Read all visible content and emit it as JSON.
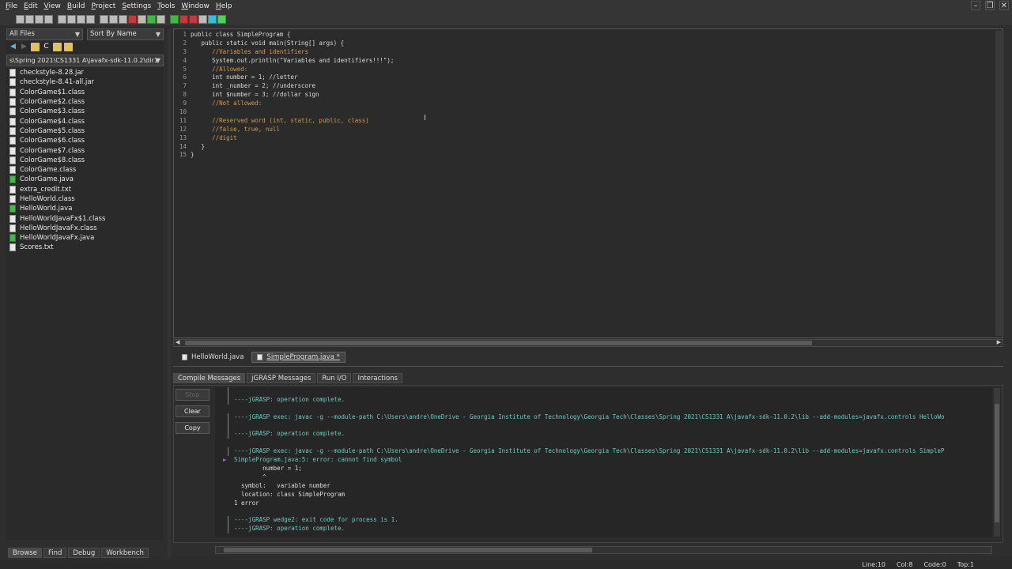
{
  "menu": [
    "File",
    "Edit",
    "View",
    "Build",
    "Project",
    "Settings",
    "Tools",
    "Window",
    "Help"
  ],
  "window_controls": [
    "minimize-icon",
    "restore-icon",
    "close-icon"
  ],
  "browser": {
    "filter": "All Files",
    "sort": "Sort By Name",
    "path": "s\\Spring 2021\\CS1331 A\\javafx-sdk-11.0.2\\dir1",
    "files": [
      {
        "name": "checkstyle-8.28.jar",
        "type": "file"
      },
      {
        "name": "checkstyle-8.41-all.jar",
        "type": "file"
      },
      {
        "name": "ColorGame$1.class",
        "type": "file"
      },
      {
        "name": "ColorGame$2.class",
        "type": "file"
      },
      {
        "name": "ColorGame$3.class",
        "type": "file"
      },
      {
        "name": "ColorGame$4.class",
        "type": "file"
      },
      {
        "name": "ColorGame$5.class",
        "type": "file"
      },
      {
        "name": "ColorGame$6.class",
        "type": "file"
      },
      {
        "name": "ColorGame$7.class",
        "type": "file"
      },
      {
        "name": "ColorGame$8.class",
        "type": "file"
      },
      {
        "name": "ColorGame.class",
        "type": "file"
      },
      {
        "name": "ColorGame.java",
        "type": "java"
      },
      {
        "name": "extra_credit.txt",
        "type": "file"
      },
      {
        "name": "HelloWorld.class",
        "type": "file"
      },
      {
        "name": "HelloWorld.java",
        "type": "java"
      },
      {
        "name": "HelloWorldJavaFx$1.class",
        "type": "file"
      },
      {
        "name": "HelloWorldJavaFx.class",
        "type": "file"
      },
      {
        "name": "HelloWorldJavaFx.java",
        "type": "java"
      },
      {
        "name": "Scores.txt",
        "type": "file"
      }
    ],
    "tabs": [
      "Browse",
      "Find",
      "Debug",
      "Workbench"
    ]
  },
  "editor": {
    "lines": [
      "public class SimpleProgram {",
      "   public static void main(String[] args) {",
      "      //Variables and identifiers",
      "      System.out.println(\"Variables and identifiers!!!\");",
      "      //Allowed:",
      "      int number = 1; //letter",
      "      int _number = 2; //underscore",
      "      int $number = 3; //dollar sign",
      "      //Not allowed:",
      "",
      "      //Reserved word (int, static, public, class)",
      "      //false, true, null",
      "      //digit",
      "   }",
      "}"
    ],
    "line_numbers": [
      "1",
      "2",
      "3",
      "4",
      "5",
      "6",
      "7",
      "8",
      "9",
      "10",
      "11",
      "12",
      "13",
      "14",
      "15"
    ],
    "file_tabs": [
      "HelloWorld.java",
      "SimpleProgram.java *"
    ]
  },
  "messages": {
    "tabs": [
      "Compile Messages",
      "jGRASP Messages",
      "Run I/O",
      "Interactions"
    ],
    "buttons": {
      "stop": "Stop",
      "clear": "Clear",
      "copy": "Copy"
    },
    "lines": [
      {
        "text": "",
        "kind": "blank",
        "bar": true
      },
      {
        "text": "----jGRASP: operation complete.",
        "kind": "jg",
        "bar": true
      },
      {
        "text": "",
        "kind": "blank",
        "bar": false
      },
      {
        "text": "----jGRASP exec: javac -g --module-path C:\\Users\\andre\\OneDrive - Georgia Institute of Technology\\Georgia Tech\\Classes\\Spring 2021\\CS1331 A\\javafx-sdk-11.0.2\\lib --add-modules=javafx.controls HelloWo",
        "kind": "jg",
        "bar": true
      },
      {
        "text": "",
        "kind": "blank",
        "bar": true
      },
      {
        "text": "----jGRASP: operation complete.",
        "kind": "jg",
        "bar": true
      },
      {
        "text": "",
        "kind": "blank",
        "bar": false
      },
      {
        "text": "----jGRASP exec: javac -g --module-path C:\\Users\\andre\\OneDrive - Georgia Institute of Technology\\Georgia Tech\\Classes\\Spring 2021\\CS1331 A\\javafx-sdk-11.0.2\\lib --add-modules=javafx.controls SimpleP",
        "kind": "jg",
        "bar": true
      },
      {
        "text": "SimpleProgram.java:5: error: cannot find symbol",
        "kind": "err",
        "bar": false,
        "marker": true
      },
      {
        "text": "        number = 1;",
        "kind": "plain",
        "bar": false
      },
      {
        "text": "        ^",
        "kind": "plain",
        "bar": false
      },
      {
        "text": "  symbol:   variable number",
        "kind": "plain",
        "bar": false
      },
      {
        "text": "  location: class SimpleProgram",
        "kind": "plain",
        "bar": false
      },
      {
        "text": "1 error",
        "kind": "plain",
        "bar": false
      },
      {
        "text": "",
        "kind": "blank",
        "bar": false
      },
      {
        "text": "----jGRASP wedge2: exit code for process is 1.",
        "kind": "jg",
        "bar": true
      },
      {
        "text": "----jGRASP: operation complete.",
        "kind": "jg",
        "bar": true
      }
    ]
  },
  "status": {
    "line": "Line:10",
    "col": "Col:8",
    "code": "Code:0",
    "top": "Top:1"
  }
}
